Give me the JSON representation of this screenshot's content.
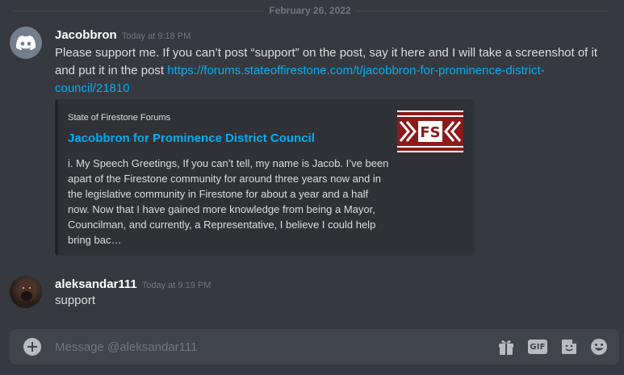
{
  "date_divider": "February 26, 2022",
  "messages": [
    {
      "author": "Jacobbron",
      "timestamp": "Today at 9:18 PM",
      "avatar_icon": "discord-logo-icon",
      "text_before_link": "Please support me. If you can’t post “support” on the post, say it here and I will take a screenshot of it and put it in the post ",
      "link": "https://forums.stateoffirestone.com/t/jacobbron-for-prominence-district-council/21810",
      "embed": {
        "provider": "State of Firestone Forums",
        "title": "Jacobbron for Prominence District Council",
        "description": "i. My Speech Greetings, If you can’t tell, my name is Jacob. I’ve been apart of the Firestone community for around three years now and in the legislative community in Firestone for about a year and a half now. Now that I have gained more knowledge from being a Mayor, Councilman, and currently, a Representative, I believe I could help bring bac…",
        "thumbnail_text": "FS"
      }
    },
    {
      "author": "aleksandar111",
      "timestamp": "Today at 9:19 PM",
      "avatar_icon": "user-photo-avatar",
      "text": "support"
    }
  ],
  "composer": {
    "placeholder": "Message @aleksandar111",
    "value": "",
    "gif_label": "GIF",
    "icons": [
      "add-attachment-icon",
      "gift-icon",
      "gif-icon",
      "sticker-icon",
      "emoji-icon"
    ]
  },
  "colors": {
    "background": "#36393f",
    "link": "#00aff4",
    "embed_bg": "#2f3136",
    "input_bg": "#40444b",
    "thumb_red": "#8b1a1a"
  }
}
